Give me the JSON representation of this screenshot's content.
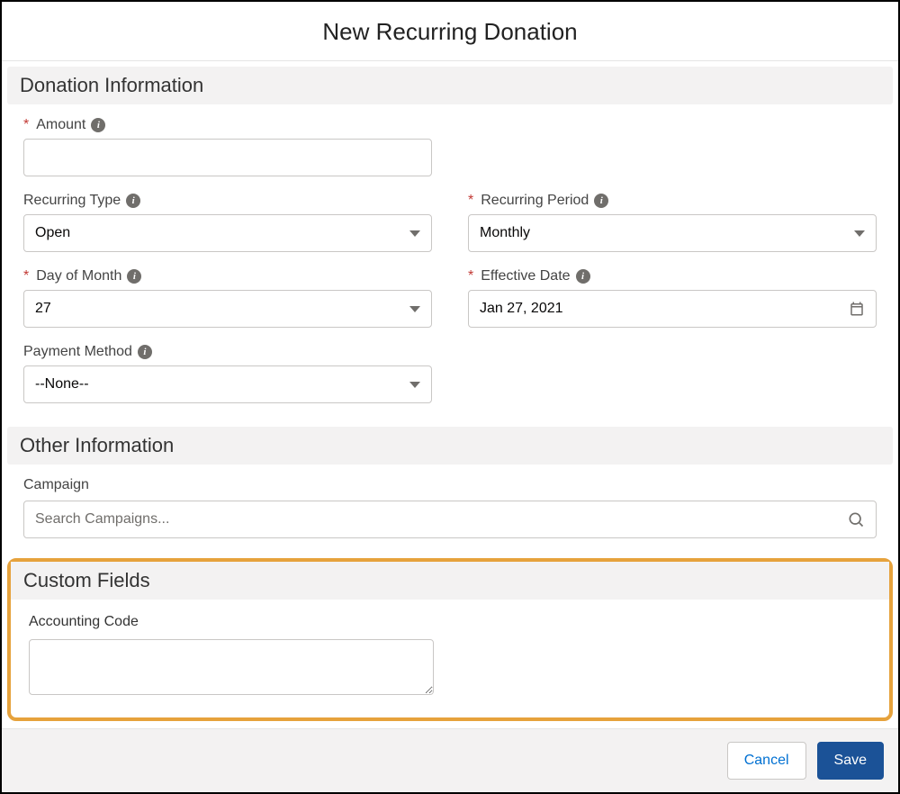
{
  "header": {
    "title": "New Recurring Donation"
  },
  "sections": {
    "donation": "Donation Information",
    "other": "Other Information",
    "custom": "Custom Fields"
  },
  "fields": {
    "amount": {
      "label": "Amount",
      "required": true,
      "info": true,
      "value": ""
    },
    "recurringType": {
      "label": "Recurring Type",
      "required": false,
      "info": true,
      "value": "Open"
    },
    "recurringPeriod": {
      "label": "Recurring Period",
      "required": true,
      "info": true,
      "value": "Monthly"
    },
    "dayOfMonth": {
      "label": "Day of Month",
      "required": true,
      "info": true,
      "value": "27"
    },
    "effectiveDate": {
      "label": "Effective Date",
      "required": true,
      "info": true,
      "value": "Jan 27, 2021"
    },
    "paymentMethod": {
      "label": "Payment Method",
      "required": false,
      "info": true,
      "value": "--None--"
    },
    "campaign": {
      "label": "Campaign",
      "placeholder": "Search Campaigns..."
    },
    "accountingCode": {
      "label": "Accounting Code",
      "value": ""
    }
  },
  "footer": {
    "cancel": "Cancel",
    "save": "Save"
  },
  "infoGlyph": "i"
}
